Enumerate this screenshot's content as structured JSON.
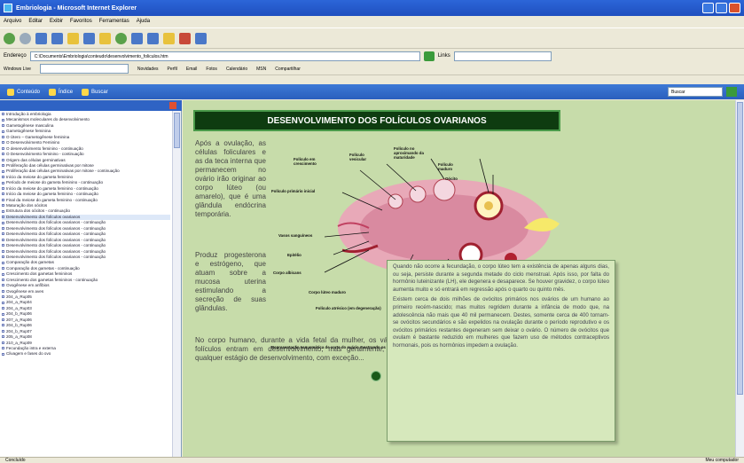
{
  "window": {
    "title": "Embriologia - Microsoft Internet Explorer"
  },
  "menu": [
    "Arquivo",
    "Editar",
    "Exibir",
    "Favoritos",
    "Ferramentas",
    "Ajuda"
  ],
  "address": {
    "label": "Endereço",
    "url": "C:\\Documents\\Embriologia\\conteudo\\desenvolvimento_foliculos.htm",
    "go_label": "Ir",
    "links_label": "Links"
  },
  "linksbar": [
    "Windows Live",
    "Novidades",
    "Perfil",
    "Email",
    "Fotos",
    "Calendário",
    "MSN",
    "Compartilhar"
  ],
  "nav": {
    "tabs": [
      "Conteúdo",
      "Índice",
      "Buscar"
    ],
    "search_placeholder": "Buscar"
  },
  "toc": {
    "items": [
      "Introdução à embriologia",
      "Mecanismos moleculares do desenvolvimento",
      "Gametogênese masculina",
      "Gametogênese feminina",
      "O Útero – Gametogênese feminina",
      "O Desenvolvimento Feminino",
      "O desenvolvimento feminino - continuação",
      "O Desenvolvimento feminino - continuação",
      "Origem das células germinativas",
      "Proliferação das células germinativas por mitose",
      "Proliferação das células germinativas por mitose - continuação",
      "Início da meiose do gameta feminino",
      "Período de meiose do gameta feminino - continuação",
      "Início da meiose do gameta feminino - continuação",
      "Início da meiose do gameta feminino - continuação",
      "Final da meiose do gameta feminino - continuação",
      "Maturação dos oócitos",
      "Estrutura dos oócitos - continuação",
      "Desenvolvimento dos folículos ovarianos",
      "Desenvolvimento dos folículos ovarianos - continuação",
      "Desenvolvimento dos folículos ovarianos - continuação",
      "Desenvolvimento dos folículos ovarianos - continuação",
      "Desenvolvimento dos folículos ovarianos - continuação",
      "Desenvolvimento dos folículos ovarianos - continuação",
      "Desenvolvimento dos folículos ovarianos - continuação",
      "Desenvolvimento dos folículos ovarianos - continuação",
      "Comparação dos gametas",
      "Comparação dos gametas - continuação",
      "Crescimento dos gametas femininos",
      "Crescimento dos gametas femininos - continuação",
      "Ovogênese em anfíbios",
      "Ovogênese em aves",
      "204_a_Rup05",
      "204_a_Rup04",
      "204_a_Rup03",
      "204_b_Rup06",
      "207_a_Rup06",
      "204_b_Rup06",
      "204_b_Rup07",
      "205_a_Rup08",
      "210_a_Rup09",
      "Fecundação intra e externa",
      "Clivagem e fases do ovo"
    ],
    "selected": 18
  },
  "content": {
    "heading": "DESENVOLVIMENTO DOS FOLÍCULOS OVARIANOS",
    "p1": "Após a ovulação, as células foliculares e as da teca interna que permanecem no ovário irão originar ao corpo lúteo (ou amarelo), que é uma glândula endócrina temporária.",
    "p2": "Produz progesterona e estrógeno, que atuam sobre a mucosa uterina estimulando a secreção de suas glândulas.",
    "p3": "No corpo humano, durante a vida fetal da mulher, os vários folículos entram em desenvolvimento, mas geralmente, em qualquer estágio de desenvolvimento, com exceção..."
  },
  "diagram_labels": [
    "Folículo em crescimento",
    "Folículo vesicular",
    "Folículo no aproximando da maturidade",
    "Folículo maduro",
    "Oócito",
    "Folículo primário inicial",
    "Vasos sanguíneos",
    "Epitélio",
    "Corpo albicans",
    "Corpo lúteo maduro",
    "Folículo atrésico (em degeneração)",
    "Oócito liberado",
    "Folículo rompido",
    "Representação esquemática de corte do ovário mostrando os folículos e corpo lúteo"
  ],
  "popup": {
    "p1": "Quando não ocorre a fecundação, o corpo lúteo tem a existência de apenas alguns dias, ou seja, persiste durante a segunda metade do ciclo menstrual. Após isso, por falta do hormônio luteinizante (LH), ele degenera e desaparece. Se houver gravidez, o corpo lúteo aumenta muito e só entrará em regressão após o quarto ou quinto mês.",
    "p2": "Existem cerca de dois milhões de ovócitos primários nos ovários de um humano ao primeiro recém-nascido; mas muitos regridem durante a infância de modo que, na adolescência não mais que 40 mil permanecem. Destes, somente cerca de 400 tornam-se ovócitos secundários e são expelidos na ovulação durante o período reprodutivo e os ovócitos primários restantes degeneram sem deixar o ovário. O número de ovócitos que ovulam é bastante reduzido em mulheres que fazem uso de métodos contraceptivos hormonais, pois os hormônios impedem a ovulação."
  },
  "status": {
    "left": "Concluído",
    "right": "Meu computador"
  }
}
